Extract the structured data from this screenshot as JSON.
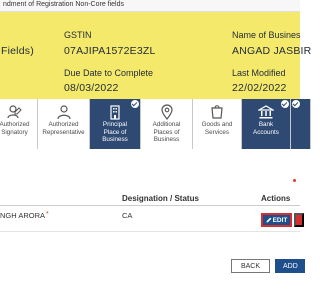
{
  "page": {
    "title_fragment": "ndment of Registration Non-Core fields"
  },
  "info": {
    "fields_label": "Fields)",
    "gstin_label": "GSTIN",
    "gstin_value": "07AJIPA1572E3ZL",
    "business_label": "Name of Busines",
    "business_value": "ANGAD JASBIR",
    "due_label": "Due Date to Complete",
    "due_value": "08/03/2022",
    "modified_label": "Last Modified",
    "modified_value": "22/02/2022"
  },
  "tabs": [
    {
      "label": "Authorized\nSignatory",
      "icon": "signatory-icon",
      "active": false,
      "checked": false
    },
    {
      "label": "Authorized\nRepresentative",
      "icon": "representative-icon",
      "active": false,
      "checked": false
    },
    {
      "label": "Principal\nPlace of\nBusiness",
      "icon": "building-icon",
      "active": true,
      "checked": true
    },
    {
      "label": "Additional\nPlaces of\nBusiness",
      "icon": "location-icon",
      "active": false,
      "checked": false
    },
    {
      "label": "Goods and\nServices",
      "icon": "goods-icon",
      "active": false,
      "checked": false
    },
    {
      "label": "Bank\nAccounts",
      "icon": "bank-icon",
      "active": true,
      "checked": true
    },
    {
      "label": "",
      "icon": "more-icon",
      "active": true,
      "checked": true
    }
  ],
  "table": {
    "headers": {
      "designation": "Designation / Status",
      "actions": "Actions"
    },
    "rows": [
      {
        "name": "NGH ARORA",
        "required_mark": "*",
        "designation": "CA"
      }
    ]
  },
  "buttons": {
    "edit": "EDIT",
    "back": "BACK",
    "add": "ADD"
  },
  "colors": {
    "info_band": "#f5e96b",
    "active_tab": "#2e4a73",
    "primary_button": "#1f4e8c",
    "danger": "#d32f2f"
  }
}
